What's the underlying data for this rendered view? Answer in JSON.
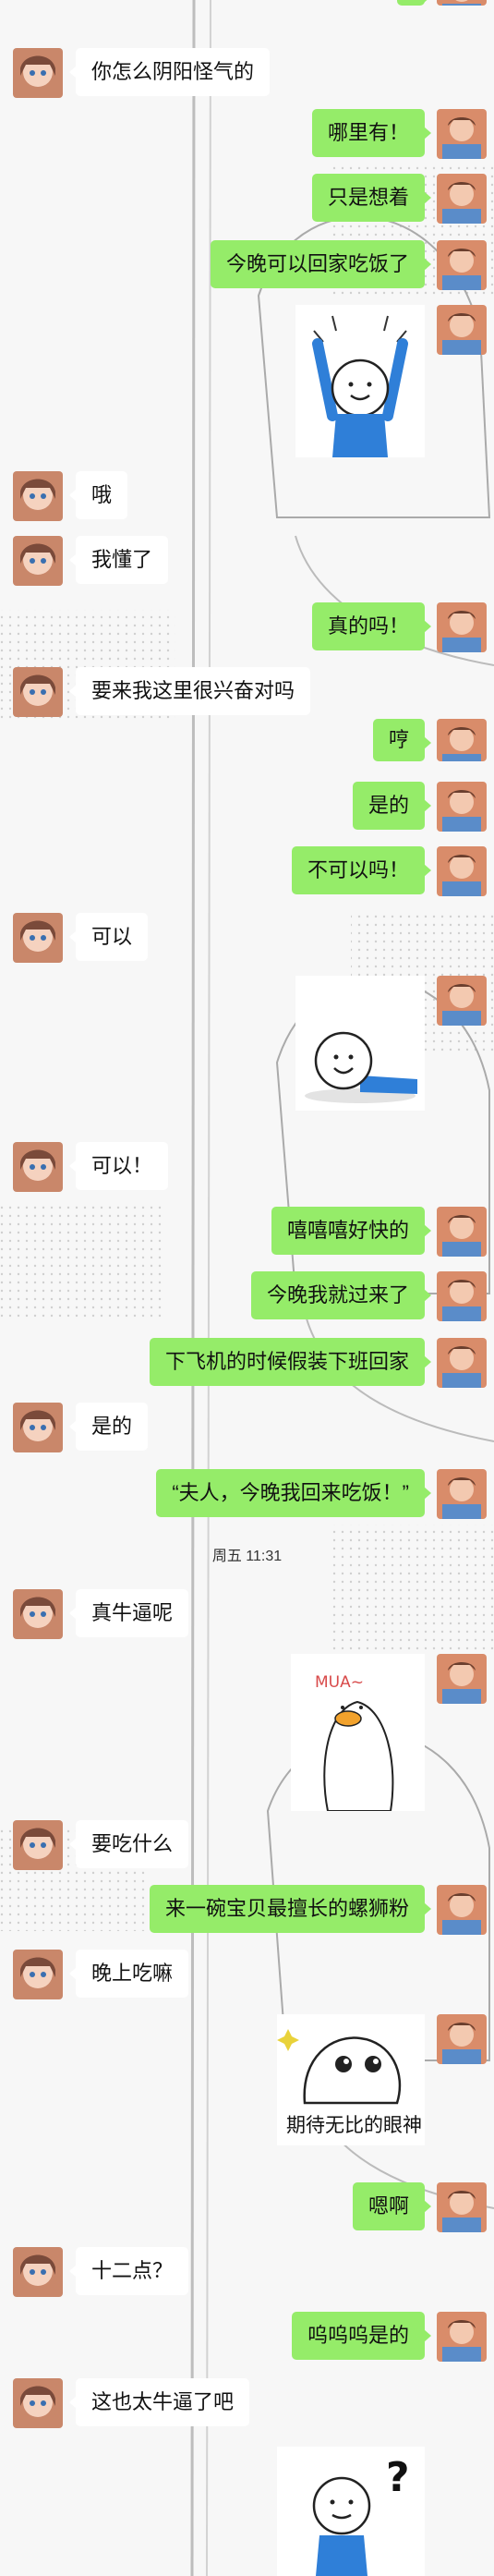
{
  "chat": {
    "timestamp": "周五 11:31",
    "messages": [
      {
        "side": "in",
        "text": "你怎么阴阳怪气的"
      },
      {
        "side": "out",
        "text": "哪里有！"
      },
      {
        "side": "out",
        "text": "只是想着"
      },
      {
        "side": "out",
        "text": "今晚可以回家吃饭了"
      },
      {
        "side": "in",
        "text": "哦"
      },
      {
        "side": "in",
        "text": "我懂了"
      },
      {
        "side": "out",
        "text": "真的吗！"
      },
      {
        "side": "in",
        "text": "要来我这里很兴奋对吗"
      },
      {
        "side": "out",
        "text": "哼"
      },
      {
        "side": "out",
        "text": "是的"
      },
      {
        "side": "out",
        "text": "不可以吗！"
      },
      {
        "side": "in",
        "text": "可以"
      },
      {
        "side": "in",
        "text": "可以！"
      },
      {
        "side": "out",
        "text": "嘻嘻嘻好快的"
      },
      {
        "side": "out",
        "text": "今晚我就过来了"
      },
      {
        "side": "out",
        "text": "下飞机的时候假装下班回家"
      },
      {
        "side": "in",
        "text": "是的"
      },
      {
        "side": "out",
        "text": "“夫人，今晚我回来吃饭！”"
      },
      {
        "side": "in",
        "text": "真牛逼呢"
      },
      {
        "side": "in",
        "text": "要吃什么"
      },
      {
        "side": "out",
        "text": "来一碗宝贝最擅长的螺狮粉"
      },
      {
        "side": "in",
        "text": "晚上吃嘛"
      },
      {
        "side": "out",
        "text": "嗯啊"
      },
      {
        "side": "in",
        "text": "十二点？"
      },
      {
        "side": "out",
        "text": "呜呜呜是的"
      },
      {
        "side": "in",
        "text": "这也太牛逼了吧"
      }
    ],
    "sticker_caption": "期待无比的眼神",
    "sticker_duck_text": "MUA~",
    "sticker_question_mark": "?"
  },
  "colors": {
    "outgoing_bubble": "#95ec69",
    "incoming_bubble": "#ffffff",
    "page_background": "#f6f6f6"
  }
}
